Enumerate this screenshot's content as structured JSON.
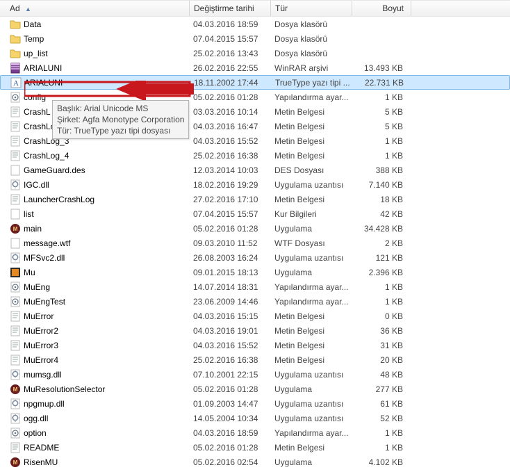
{
  "columns": {
    "name": "Ad",
    "date": "Değiştirme tarihi",
    "type": "Tür",
    "size": "Boyut"
  },
  "tooltip": {
    "line1": "Başlık: Arial Unicode MS",
    "line2": "Şirket: Agfa Monotype Corporation",
    "line3": "Tür: TrueType yazı tipi dosyası"
  },
  "files": [
    {
      "name": "Data",
      "date": "04.03.2016 18:59",
      "type": "Dosya klasörü",
      "size": "",
      "icon": "folder"
    },
    {
      "name": "Temp",
      "date": "07.04.2015 15:57",
      "type": "Dosya klasörü",
      "size": "",
      "icon": "folder"
    },
    {
      "name": "up_list",
      "date": "25.02.2016 13:43",
      "type": "Dosya klasörü",
      "size": "",
      "icon": "folder"
    },
    {
      "name": "ARIALUNI",
      "date": "26.02.2016 22:55",
      "type": "WinRAR arşivi",
      "size": "13.493 KB",
      "icon": "rar"
    },
    {
      "name": "ARIALUNI",
      "date": "18.11.2002 17:44",
      "type": "TrueType yazı tipi ...",
      "size": "22.731 KB",
      "icon": "font",
      "selected": true
    },
    {
      "name": "config",
      "date": "05.02.2016 01:28",
      "type": "Yapılandırma ayar...",
      "size": "1 KB",
      "icon": "ini"
    },
    {
      "name": "CrashL",
      "date": "03.03.2016 10:14",
      "type": "Metin Belgesi",
      "size": "5 KB",
      "icon": "txt"
    },
    {
      "name": "CrashLog_2",
      "date": "04.03.2016 16:47",
      "type": "Metin Belgesi",
      "size": "5 KB",
      "icon": "txt"
    },
    {
      "name": "CrashLog_3",
      "date": "04.03.2016 15:52",
      "type": "Metin Belgesi",
      "size": "1 KB",
      "icon": "txt"
    },
    {
      "name": "CrashLog_4",
      "date": "25.02.2016 16:38",
      "type": "Metin Belgesi",
      "size": "1 KB",
      "icon": "txt"
    },
    {
      "name": "GameGuard.des",
      "date": "12.03.2014 10:03",
      "type": "DES Dosyası",
      "size": "388 KB",
      "icon": "file"
    },
    {
      "name": "IGC.dll",
      "date": "18.02.2016 19:29",
      "type": "Uygulama uzantısı",
      "size": "7.140 KB",
      "icon": "dll"
    },
    {
      "name": "LauncherCrashLog",
      "date": "27.02.2016 17:10",
      "type": "Metin Belgesi",
      "size": "18 KB",
      "icon": "txt"
    },
    {
      "name": "list",
      "date": "07.04.2015 15:57",
      "type": "Kur Bilgileri",
      "size": "42 KB",
      "icon": "file"
    },
    {
      "name": "main",
      "date": "05.02.2016 01:28",
      "type": "Uygulama",
      "size": "34.428 KB",
      "icon": "app-mu"
    },
    {
      "name": "message.wtf",
      "date": "09.03.2010 11:52",
      "type": "WTF Dosyası",
      "size": "2 KB",
      "icon": "file"
    },
    {
      "name": "MFSvc2.dll",
      "date": "26.08.2003 16:24",
      "type": "Uygulama uzantısı",
      "size": "121 KB",
      "icon": "dll"
    },
    {
      "name": "Mu",
      "date": "09.01.2015 18:13",
      "type": "Uygulama",
      "size": "2.396 KB",
      "icon": "app-orange"
    },
    {
      "name": "MuEng",
      "date": "14.07.2014 18:31",
      "type": "Yapılandırma ayar...",
      "size": "1 KB",
      "icon": "ini"
    },
    {
      "name": "MuEngTest",
      "date": "23.06.2009 14:46",
      "type": "Yapılandırma ayar...",
      "size": "1 KB",
      "icon": "ini"
    },
    {
      "name": "MuError",
      "date": "04.03.2016 15:15",
      "type": "Metin Belgesi",
      "size": "0 KB",
      "icon": "txt"
    },
    {
      "name": "MuError2",
      "date": "04.03.2016 19:01",
      "type": "Metin Belgesi",
      "size": "36 KB",
      "icon": "txt"
    },
    {
      "name": "MuError3",
      "date": "04.03.2016 15:52",
      "type": "Metin Belgesi",
      "size": "31 KB",
      "icon": "txt"
    },
    {
      "name": "MuError4",
      "date": "25.02.2016 16:38",
      "type": "Metin Belgesi",
      "size": "20 KB",
      "icon": "txt"
    },
    {
      "name": "mumsg.dll",
      "date": "07.10.2001 22:15",
      "type": "Uygulama uzantısı",
      "size": "48 KB",
      "icon": "dll"
    },
    {
      "name": "MuResolutionSelector",
      "date": "05.02.2016 01:28",
      "type": "Uygulama",
      "size": "277 KB",
      "icon": "app-mu"
    },
    {
      "name": "npgmup.dll",
      "date": "01.09.2003 14:47",
      "type": "Uygulama uzantısı",
      "size": "61 KB",
      "icon": "dll"
    },
    {
      "name": "ogg.dll",
      "date": "14.05.2004 10:34",
      "type": "Uygulama uzantısı",
      "size": "52 KB",
      "icon": "dll"
    },
    {
      "name": "option",
      "date": "04.03.2016 18:59",
      "type": "Yapılandırma ayar...",
      "size": "1 KB",
      "icon": "ini"
    },
    {
      "name": "README",
      "date": "05.02.2016 01:28",
      "type": "Metin Belgesi",
      "size": "1 KB",
      "icon": "txt"
    },
    {
      "name": "RisenMU",
      "date": "05.02.2016 02:54",
      "type": "Uygulama",
      "size": "4.102 KB",
      "icon": "app-mu"
    }
  ]
}
